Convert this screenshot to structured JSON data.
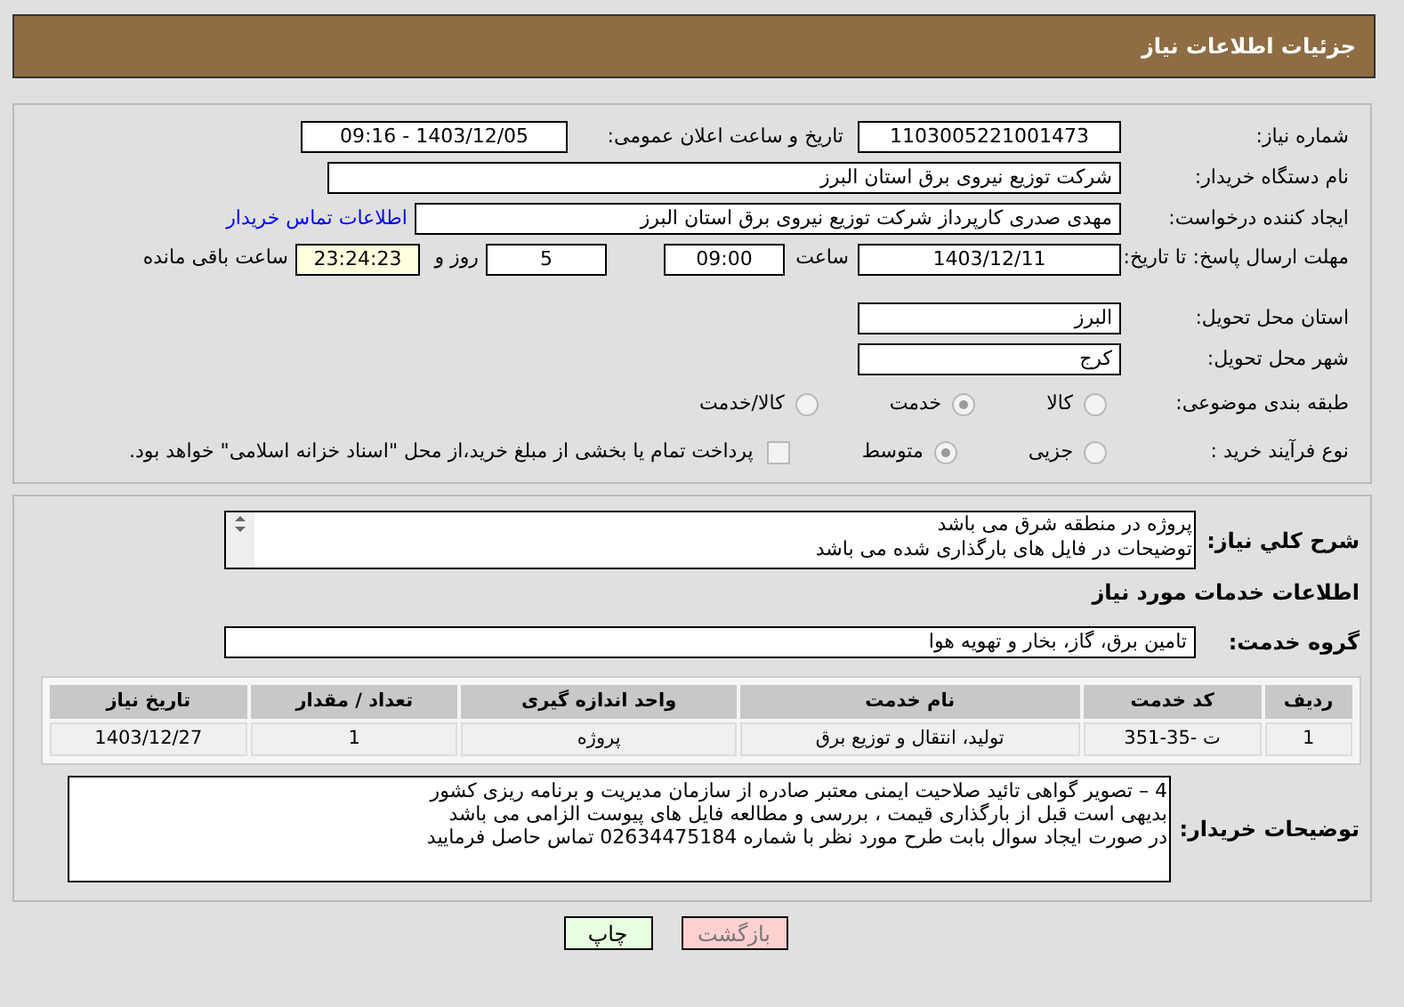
{
  "header": {
    "title": "جزئیات اطلاعات نیاز"
  },
  "need_number": {
    "label": "شماره نیاز:",
    "value": "1103005221001473"
  },
  "announce_date": {
    "label": "تاریخ و ساعت اعلان عمومی:",
    "value": "1403/12/05 - 09:16"
  },
  "buyer_org": {
    "label": "نام دستگاه خریدار:",
    "value": "شرکت توزیع نیروی برق استان البرز"
  },
  "requester": {
    "label": "ایجاد کننده درخواست:",
    "value": "مهدی صدری کارپرداز شرکت توزیع نیروی برق استان البرز",
    "link": "اطلاعات تماس خریدار"
  },
  "deadline": {
    "label": "مهلت ارسال پاسخ: تا تاریخ:",
    "date": "1403/12/11",
    "time_label": "ساعت",
    "time": "09:00",
    "days": "5",
    "days_label": "روز و",
    "remaining": "23:24:23",
    "remaining_label": "ساعت باقی مانده"
  },
  "province": {
    "label": "استان محل تحویل:",
    "value": "البرز"
  },
  "city": {
    "label": "شهر محل تحویل:",
    "value": "کرج"
  },
  "category": {
    "label": "طبقه بندی موضوعی:",
    "options": [
      {
        "label": "کالا",
        "selected": false
      },
      {
        "label": "خدمت",
        "selected": true
      },
      {
        "label": "کالا/خدمت",
        "selected": false
      }
    ]
  },
  "process": {
    "label": "نوع فرآیند خرید :",
    "options": [
      {
        "label": "جزیی",
        "selected": false
      },
      {
        "label": "متوسط",
        "selected": true
      }
    ],
    "payment": {
      "checked": false,
      "text": "پرداخت تمام یا بخشی از مبلغ خرید،از محل \"اسناد خزانه اسلامی\" خواهد بود."
    }
  },
  "description": {
    "label": "شرح کلي نياز:",
    "lines": [
      "پروژه در منطقه شرق می باشد",
      "توضیحات در فایل های بارگذاری شده می باشد"
    ]
  },
  "services_heading": "اطلاعات خدمات مورد نياز",
  "service_group": {
    "label": "گروه خدمت:",
    "value": "تامین برق، گاز، بخار و تهویه هوا"
  },
  "table": {
    "columns": [
      "ردیف",
      "کد خدمت",
      "نام خدمت",
      "واحد اندازه گیری",
      "تعداد / مقدار",
      "تاریخ نیاز"
    ],
    "rows": [
      [
        "1",
        "ت -35-351",
        "تولید، انتقال و توزیع برق",
        "پروژه",
        "1",
        "1403/12/27"
      ]
    ]
  },
  "buyer_notes": {
    "label": "توضیحات خریدار:",
    "lines": [
      "4 – تصویر گواهی تائید صلاحیت ایمنی معتبر صادره از سازمان مدیریت و برنامه ریزی کشور",
      "بدیهی است قبل از بارگذاری قیمت ، بررسی و مطالعه فایل های پیوست الزامی می باشد",
      "در صورت ایجاد سوال بابت طرح مورد نظر با شماره 02634475184 تماس حاصل فرمایید"
    ]
  },
  "buttons": [
    {
      "label": "بازگشت",
      "kind": "back"
    },
    {
      "label": "چاپ",
      "kind": "print"
    }
  ]
}
